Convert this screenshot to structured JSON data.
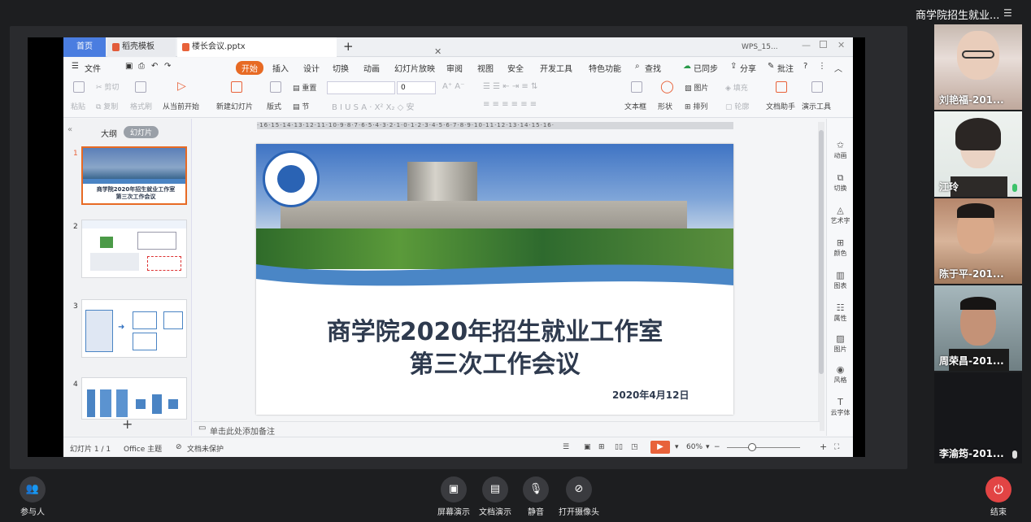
{
  "meeting": {
    "title": "商学院招生就业...",
    "menu_icon": "list-icon"
  },
  "wps": {
    "tabs": [
      {
        "label": "首页"
      },
      {
        "label": "稻壳模板"
      },
      {
        "label": "楼长会议.pptx"
      }
    ],
    "window_label": "WPS_15...",
    "menu": {
      "file": "文件",
      "items": [
        "开始",
        "插入",
        "设计",
        "切换",
        "动画",
        "幻灯片放映",
        "审阅",
        "视图",
        "安全",
        "开发工具",
        "特色功能"
      ],
      "search": "查找",
      "sync": "已同步",
      "share": "分享",
      "comment": "批注"
    },
    "toolbar": {
      "paste": "粘贴",
      "cut": "剪切",
      "copy": "复制",
      "format_painter": "格式刷",
      "from_current": "从当前开始",
      "new_slide": "新建幻灯片",
      "layout": "版式",
      "reset": "重置",
      "section": "节",
      "font_size": "0",
      "textbox": "文本框",
      "shape": "形状",
      "image": "图片",
      "arrange": "排列",
      "fill": "填充",
      "outline": "轮廓",
      "doc_assistant": "文档助手",
      "present_tool": "演示工具"
    },
    "panel": {
      "outline_tab": "大纲",
      "slides_tab": "幻灯片"
    },
    "thumbs": [
      "1",
      "2",
      "3",
      "4"
    ],
    "thumb1_text": [
      "商学院2020年招生就业工作室",
      "第三次工作会议"
    ],
    "ruler": "·16·15·14·13·12·11·10·9·8·7·6·5·4·3·2·1·0·1·2·3·4·5·6·7·8·9·10·11·12·13·14·15·16·",
    "slide": {
      "title_line1": "商学院2020年招生就业工作室",
      "title_line2": "第三次工作会议",
      "date": "2020年4月12日"
    },
    "notes_placeholder": "单击此处添加备注",
    "right_tools": [
      "动画",
      "切换",
      "艺术字",
      "颜色",
      "图表",
      "属性",
      "图片",
      "风格",
      "云字体"
    ],
    "status": {
      "slide_counter": "幻灯片 1 / 1",
      "theme": "Office 主题",
      "protection": "文档未保护",
      "zoom": "60%"
    }
  },
  "participants": [
    {
      "name": "刘艳福-201..."
    },
    {
      "name": "江玲"
    },
    {
      "name": "陈于平-201..."
    },
    {
      "name": "周荣昌-201..."
    },
    {
      "name": "李渝筠-201..."
    }
  ],
  "controls": {
    "participants": "参与人",
    "screen_share": "屏幕演示",
    "doc_share": "文档演示",
    "mute": "静音",
    "camera": "打开摄像头",
    "end": "结束"
  }
}
